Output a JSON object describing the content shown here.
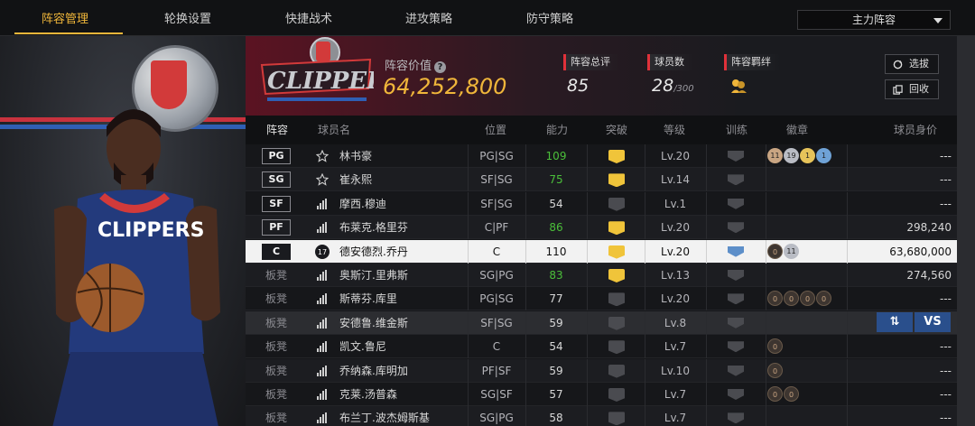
{
  "nav": {
    "tabs": [
      "阵容管理",
      "轮换设置",
      "快捷战术",
      "进攻策略",
      "防守策略"
    ],
    "active_index": 0,
    "lineup_select": "主力阵容"
  },
  "team": {
    "logo_text": "CLIPPERS",
    "value_label": "阵容价值",
    "value": "64,252,800",
    "stats": [
      {
        "label": "阵容总评",
        "value": "85",
        "sub": ""
      },
      {
        "label": "球员数",
        "value": "28",
        "sub": "/300"
      },
      {
        "label": "阵容羁绊",
        "value": "",
        "sub": ""
      }
    ],
    "buttons": {
      "scout": "选拔",
      "recycle": "回收"
    }
  },
  "colors": {
    "accent": "#f0b63a",
    "red": "#e0313a",
    "green": "#4bbf3a",
    "blue": "#2a4f8c"
  },
  "table": {
    "headers": [
      "阵容",
      "球员名",
      "位置",
      "能力",
      "突破",
      "等级",
      "训练",
      "徽章",
      "球员身价"
    ],
    "rows": [
      {
        "slot": "PG",
        "bench": false,
        "type": "star",
        "name": "林书豪",
        "position": "PG|SG",
        "ability": "109",
        "boosted": true,
        "breakthrough": "gold",
        "level": "Lv.20",
        "trained": false,
        "badges": [
          "11",
          "19",
          "1",
          "1"
        ],
        "value": "---"
      },
      {
        "slot": "SG",
        "bench": false,
        "type": "star",
        "name": "崔永熙",
        "position": "SF|SG",
        "ability": "75",
        "boosted": true,
        "breakthrough": "gold",
        "level": "Lv.14",
        "trained": false,
        "badges": [],
        "value": "---"
      },
      {
        "slot": "SF",
        "bench": false,
        "type": "bars",
        "name": "摩西.穆迪",
        "position": "SF|SG",
        "ability": "54",
        "boosted": false,
        "breakthrough": "none",
        "level": "Lv.1",
        "trained": false,
        "badges": [],
        "value": "---"
      },
      {
        "slot": "PF",
        "bench": false,
        "type": "bars",
        "name": "布莱克.格里芬",
        "position": "C|PF",
        "ability": "86",
        "boosted": true,
        "breakthrough": "gold",
        "level": "Lv.20",
        "trained": false,
        "badges": [],
        "value": "298,240"
      },
      {
        "slot": "C",
        "bench": false,
        "type": "jersey",
        "jersey": "17",
        "name": "德安德烈.乔丹",
        "position": "C",
        "ability": "110",
        "boosted": false,
        "breakthrough": "gold",
        "level": "Lv.20",
        "trained": true,
        "badges": [
          "0",
          "11"
        ],
        "value": "63,680,000",
        "selected": true
      },
      {
        "slot": "板凳",
        "bench": true,
        "type": "bars",
        "name": "奥斯汀.里弗斯",
        "position": "SG|PG",
        "ability": "83",
        "boosted": true,
        "breakthrough": "gold",
        "level": "Lv.13",
        "trained": false,
        "badges": [],
        "value": "274,560"
      },
      {
        "slot": "板凳",
        "bench": true,
        "type": "bars",
        "name": "斯蒂芬.库里",
        "position": "PG|SG",
        "ability": "77",
        "boosted": false,
        "breakthrough": "none",
        "level": "Lv.20",
        "trained": false,
        "badges": [
          "0",
          "0",
          "0",
          "0"
        ],
        "value": "---"
      },
      {
        "slot": "板凳",
        "bench": true,
        "type": "bars",
        "name": "安德鲁.维金斯",
        "position": "SF|SG",
        "ability": "59",
        "boosted": false,
        "breakthrough": "none",
        "level": "Lv.8",
        "trained": false,
        "badges": [],
        "value": "",
        "bench_selected": true
      },
      {
        "slot": "板凳",
        "bench": true,
        "type": "bars",
        "name": "凯文.鲁尼",
        "position": "C",
        "ability": "54",
        "boosted": false,
        "breakthrough": "none",
        "level": "Lv.7",
        "trained": false,
        "badges": [
          "0"
        ],
        "value": "---"
      },
      {
        "slot": "板凳",
        "bench": true,
        "type": "bars",
        "name": "乔纳森.库明加",
        "position": "PF|SF",
        "ability": "59",
        "boosted": false,
        "breakthrough": "none",
        "level": "Lv.10",
        "trained": false,
        "badges": [
          "0"
        ],
        "value": "---"
      },
      {
        "slot": "板凳",
        "bench": true,
        "type": "bars",
        "name": "克莱.汤普森",
        "position": "SG|SF",
        "ability": "57",
        "boosted": false,
        "breakthrough": "none",
        "level": "Lv.7",
        "trained": false,
        "badges": [
          "0",
          "0"
        ],
        "value": "---"
      },
      {
        "slot": "板凳",
        "bench": true,
        "type": "bars",
        "name": "布兰丁.波杰姆斯基",
        "position": "SG|PG",
        "ability": "58",
        "boosted": false,
        "breakthrough": "none",
        "level": "Lv.7",
        "trained": false,
        "badges": [],
        "value": "---"
      }
    ],
    "swap_label": "⇅",
    "vs_label": "VS"
  }
}
